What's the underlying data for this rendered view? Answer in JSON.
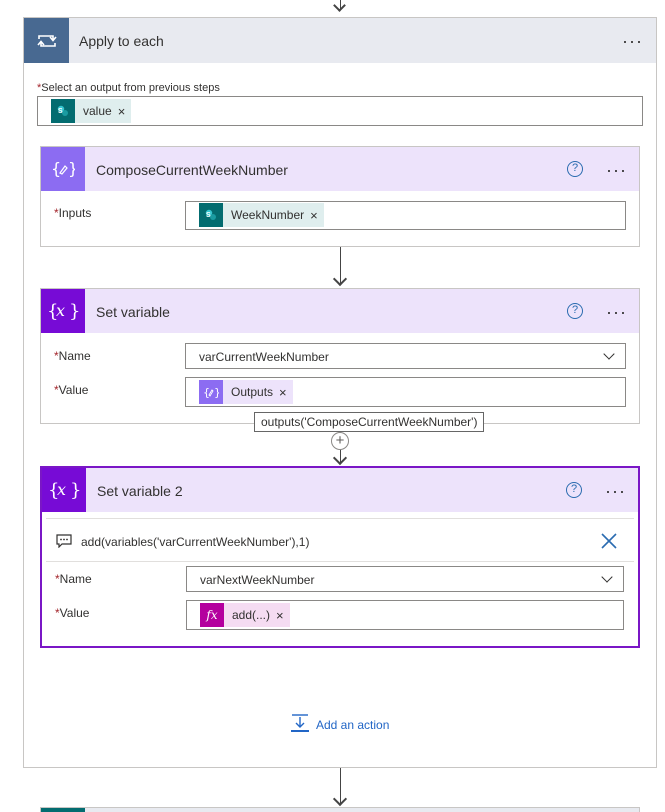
{
  "apply_each": {
    "title": "Apply to each",
    "select_label": "Select an output from previous steps",
    "required_mark": "*",
    "token": "value",
    "token_remove": "×",
    "more": "···"
  },
  "compose": {
    "title": "ComposeCurrentWeekNumber",
    "inputs_label": "Inputs",
    "required_mark": "*",
    "token": "WeekNumber",
    "token_remove": "×",
    "help": "?",
    "more": "···"
  },
  "set_variable": {
    "title": "Set variable",
    "name_label": "Name",
    "value_label": "Value",
    "required_mark": "*",
    "name_value": "varCurrentWeekNumber",
    "value_token": "Outputs",
    "token_remove": "×",
    "help": "?",
    "more": "···"
  },
  "tooltip": {
    "text": "outputs('ComposeCurrentWeekNumber')"
  },
  "set_variable_2": {
    "title": "Set variable 2",
    "expression": "add(variables('varCurrentWeekNumber'),1)",
    "name_label": "Name",
    "value_label": "Value",
    "required_mark": "*",
    "name_value": "varNextWeekNumber",
    "value_token": "add(...)",
    "token_remove": "×",
    "help": "?",
    "more": "···"
  },
  "add_action": {
    "label": "Add an action"
  },
  "icons": {
    "loop": "loop-icon",
    "sharepoint": "sharepoint-icon",
    "compose": "compose-icon",
    "variable": "variable-icon",
    "expression": "fx-icon",
    "comment": "comment-icon",
    "close": "close-icon",
    "add_action": "add-action-icon"
  },
  "colors": {
    "apply_header": "#e8eaf0",
    "apply_icon": "#486991",
    "compose_icon": "#8c6cf2",
    "variable_icon": "#770bd6",
    "card_header": "#ede3fb",
    "sharepoint": "#036c70",
    "fx": "#b4009e",
    "selected_border": "#7a16c6",
    "link": "#2266c6"
  }
}
